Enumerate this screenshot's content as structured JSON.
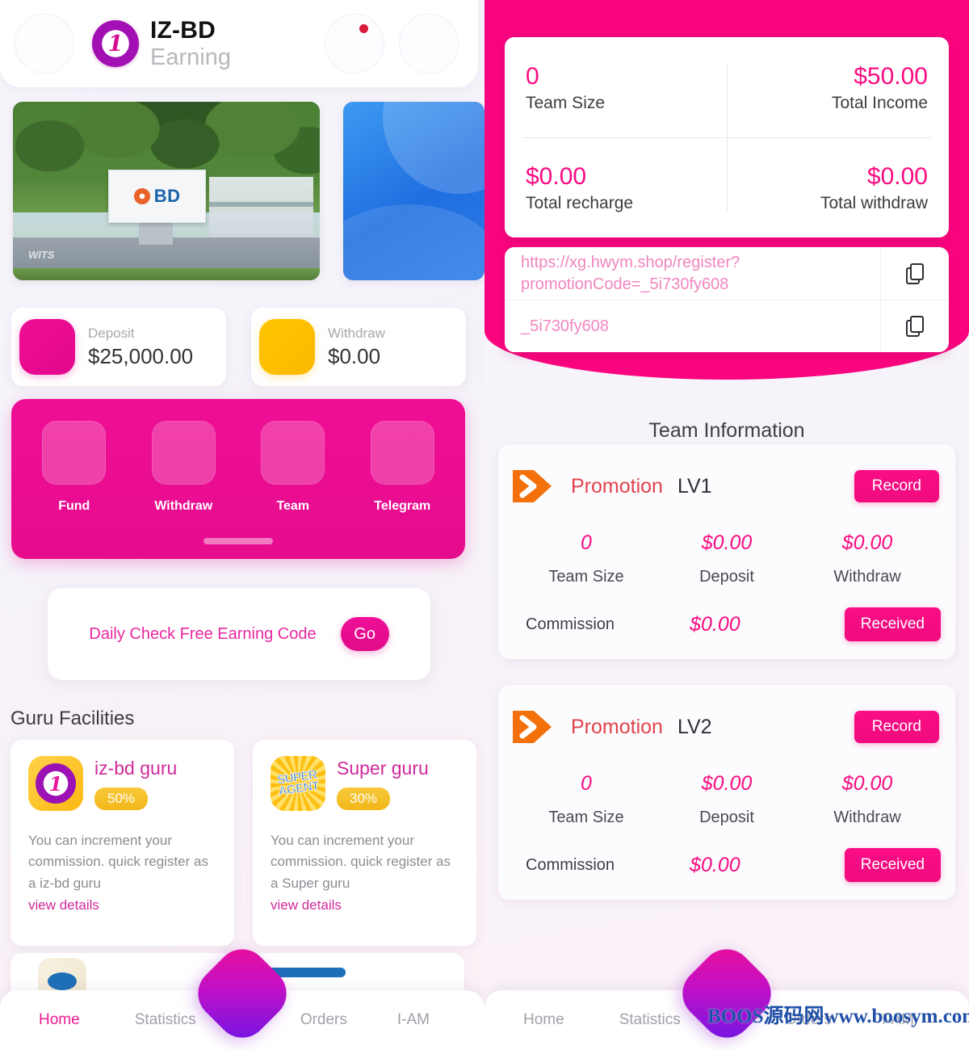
{
  "left": {
    "header": {
      "brand_title": "IZ-BD",
      "brand_sub": "Earning",
      "logo_text": "1"
    },
    "banner": {
      "sign_text": "BD",
      "watermark": "WITS"
    },
    "balances": [
      {
        "label": "Deposit",
        "value": "$25,000.00",
        "icon": "wallet-icon",
        "color": "#ef0e96"
      },
      {
        "label": "Withdraw",
        "value": "$0.00",
        "icon": "withdraw-icon",
        "color": "#ffc400"
      }
    ],
    "quick_actions": [
      {
        "label": "Fund",
        "icon": "fund-icon"
      },
      {
        "label": "Withdraw",
        "icon": "withdraw-icon"
      },
      {
        "label": "Team",
        "icon": "team-icon"
      },
      {
        "label": "Telegram",
        "icon": "telegram-icon"
      }
    ],
    "daily": {
      "text": "Daily Check Free Earning Code",
      "button": "Go"
    },
    "guru_section_title": "Guru Facilities",
    "guru_cards": [
      {
        "name": "iz-bd guru",
        "percent": "50%",
        "badge_text": "1",
        "description": "You can increment your commission. quick register as a iz-bd guru",
        "link": "view details"
      },
      {
        "name": "Super guru",
        "percent": "30%",
        "badge_text": "SUPER AGENT",
        "description": "You can increment your commission. quick register as a Super guru",
        "link": "view details"
      }
    ],
    "nav": {
      "items": [
        {
          "label": "Home",
          "active": true
        },
        {
          "label": "Statistics",
          "active": false
        },
        {
          "label": "Orders",
          "active": false
        },
        {
          "label": "I-AM",
          "active": false
        }
      ],
      "fab": "add-fab"
    }
  },
  "right": {
    "stats": [
      {
        "value": "0",
        "label": "Team Size",
        "align": "left"
      },
      {
        "value": "$50.00",
        "label": "Total Income",
        "align": "right"
      },
      {
        "value": "$0.00",
        "label": "Total recharge",
        "align": "left"
      },
      {
        "value": "$0.00",
        "label": "Total withdraw",
        "align": "right"
      }
    ],
    "referral": {
      "link": "https://xg.hwym.shop/register?promotionCode=_5i730fy608",
      "code": "_5i730fy608",
      "copy_icon": "copy-icon"
    },
    "team_title": "Team Information",
    "promotions": [
      {
        "title": "Promotion",
        "level": "LV1",
        "record_button": "Record",
        "stats": [
          {
            "value": "0",
            "label": "Team Size"
          },
          {
            "value": "$0.00",
            "label": "Deposit"
          },
          {
            "value": "$0.00",
            "label": "Withdraw"
          }
        ],
        "commission_label": "Commission",
        "commission_value": "$0.00",
        "received_button": "Received"
      },
      {
        "title": "Promotion",
        "level": "LV2",
        "record_button": "Record",
        "stats": [
          {
            "value": "0",
            "label": "Team Size"
          },
          {
            "value": "$0.00",
            "label": "Deposit"
          },
          {
            "value": "$0.00",
            "label": "Withdraw"
          }
        ],
        "commission_label": "Commission",
        "commission_value": "$0.00",
        "received_button": "Received"
      }
    ],
    "watermark": "BOOS源码网www.boosym.com",
    "nav": {
      "items": [
        {
          "label": "Home",
          "active": false
        },
        {
          "label": "Statistics",
          "active": false
        },
        {
          "label": "Orders",
          "active": false
        },
        {
          "label": "I-AM",
          "active": false
        }
      ],
      "fab": "add-fab"
    }
  },
  "theme": {
    "pink": "#fa057f",
    "magenta": "#ef0e96",
    "gold": "#ffc400",
    "orange": "#f4700b"
  }
}
